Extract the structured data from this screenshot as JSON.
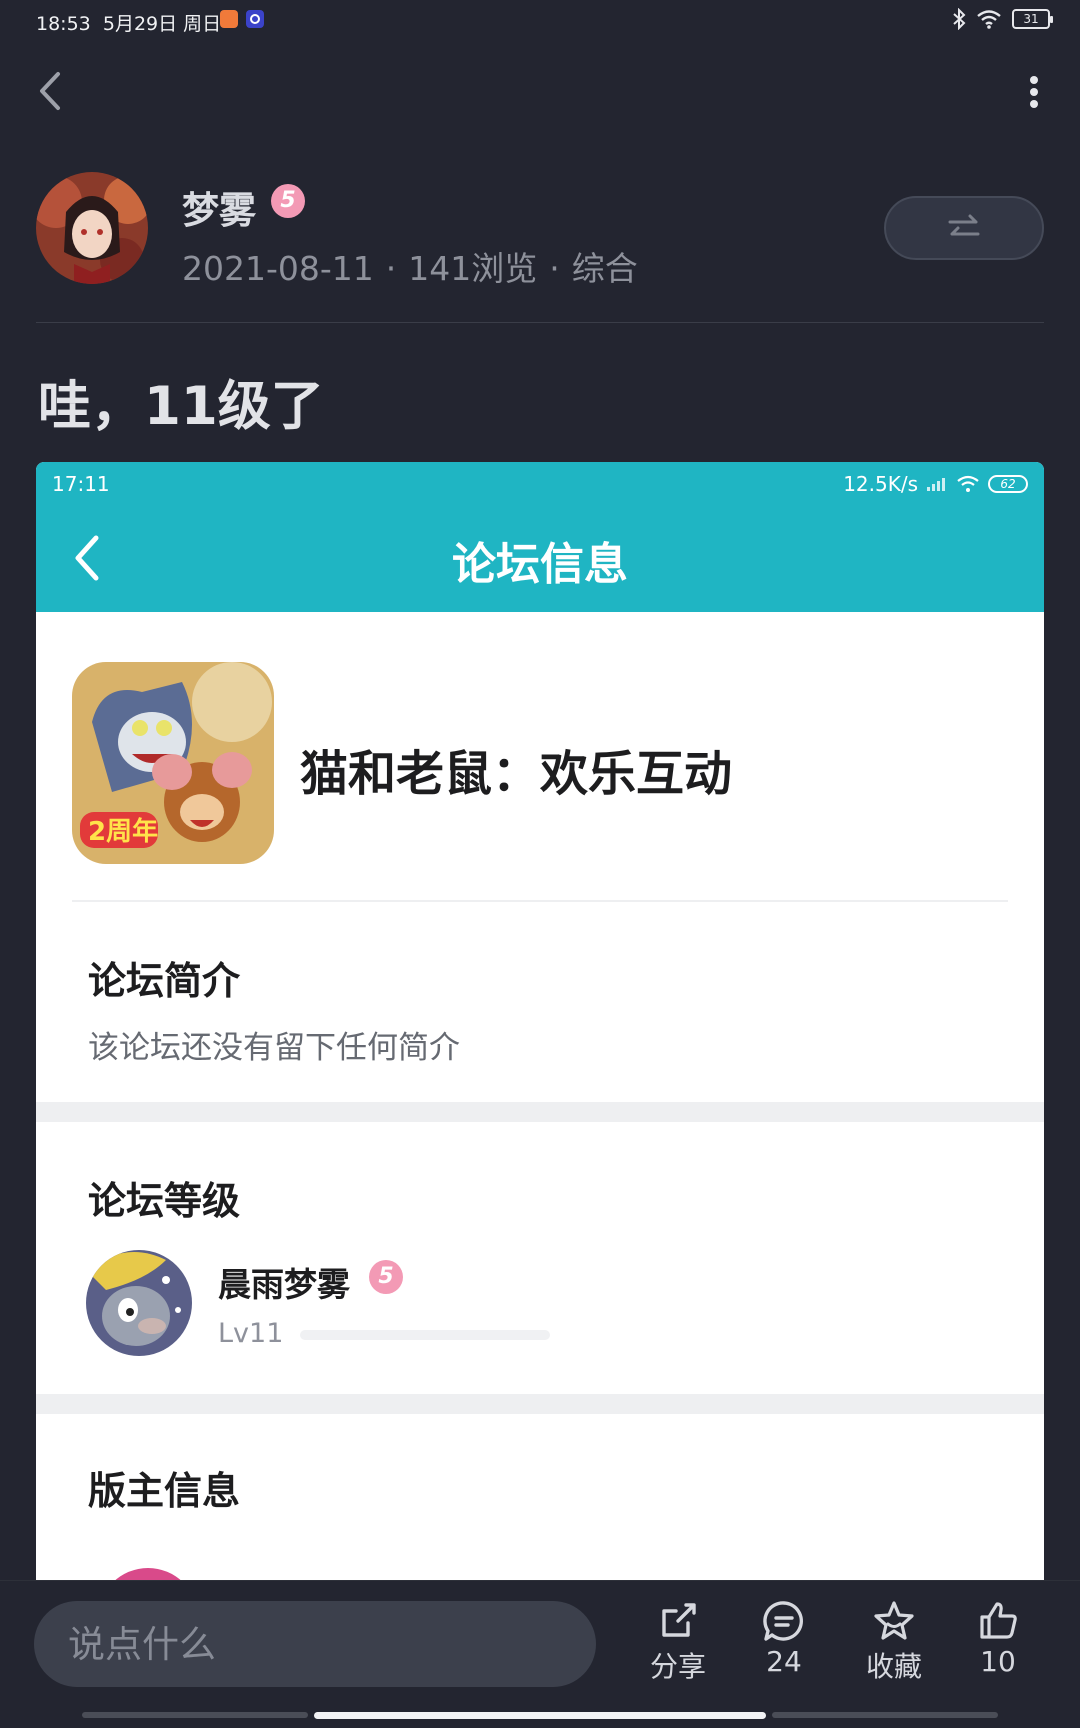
{
  "status_bar": {
    "time": "18:53",
    "date": "5月29日 周日",
    "battery": "31"
  },
  "post": {
    "author": {
      "name": "梦雾",
      "level_badge": "5"
    },
    "meta": {
      "date": "2021-08-11",
      "views": "141浏览",
      "category": "综合"
    },
    "title": "哇，11级了"
  },
  "screenshot": {
    "status_time": "17:11",
    "network_speed": "12.5K/s",
    "battery": "62",
    "header_title": "论坛信息",
    "game_name": "猫和老鼠：欢乐互动",
    "intro_title": "论坛简介",
    "intro_text": "该论坛还没有留下任何简介",
    "level_title": "论坛等级",
    "user": {
      "name": "晨雨梦雾",
      "level_badge": "5",
      "level": "Lv11",
      "progress_fraction": 0.0
    },
    "moderator_title": "版主信息"
  },
  "bottom_bar": {
    "comment_placeholder": "说点什么",
    "share_label": "分享",
    "comment_count": "24",
    "favorite_label": "收藏",
    "like_count": "10"
  },
  "colors": {
    "background": "#232530",
    "accent_teal": "#1fb5c3",
    "badge_pink": "#f39ab5"
  }
}
